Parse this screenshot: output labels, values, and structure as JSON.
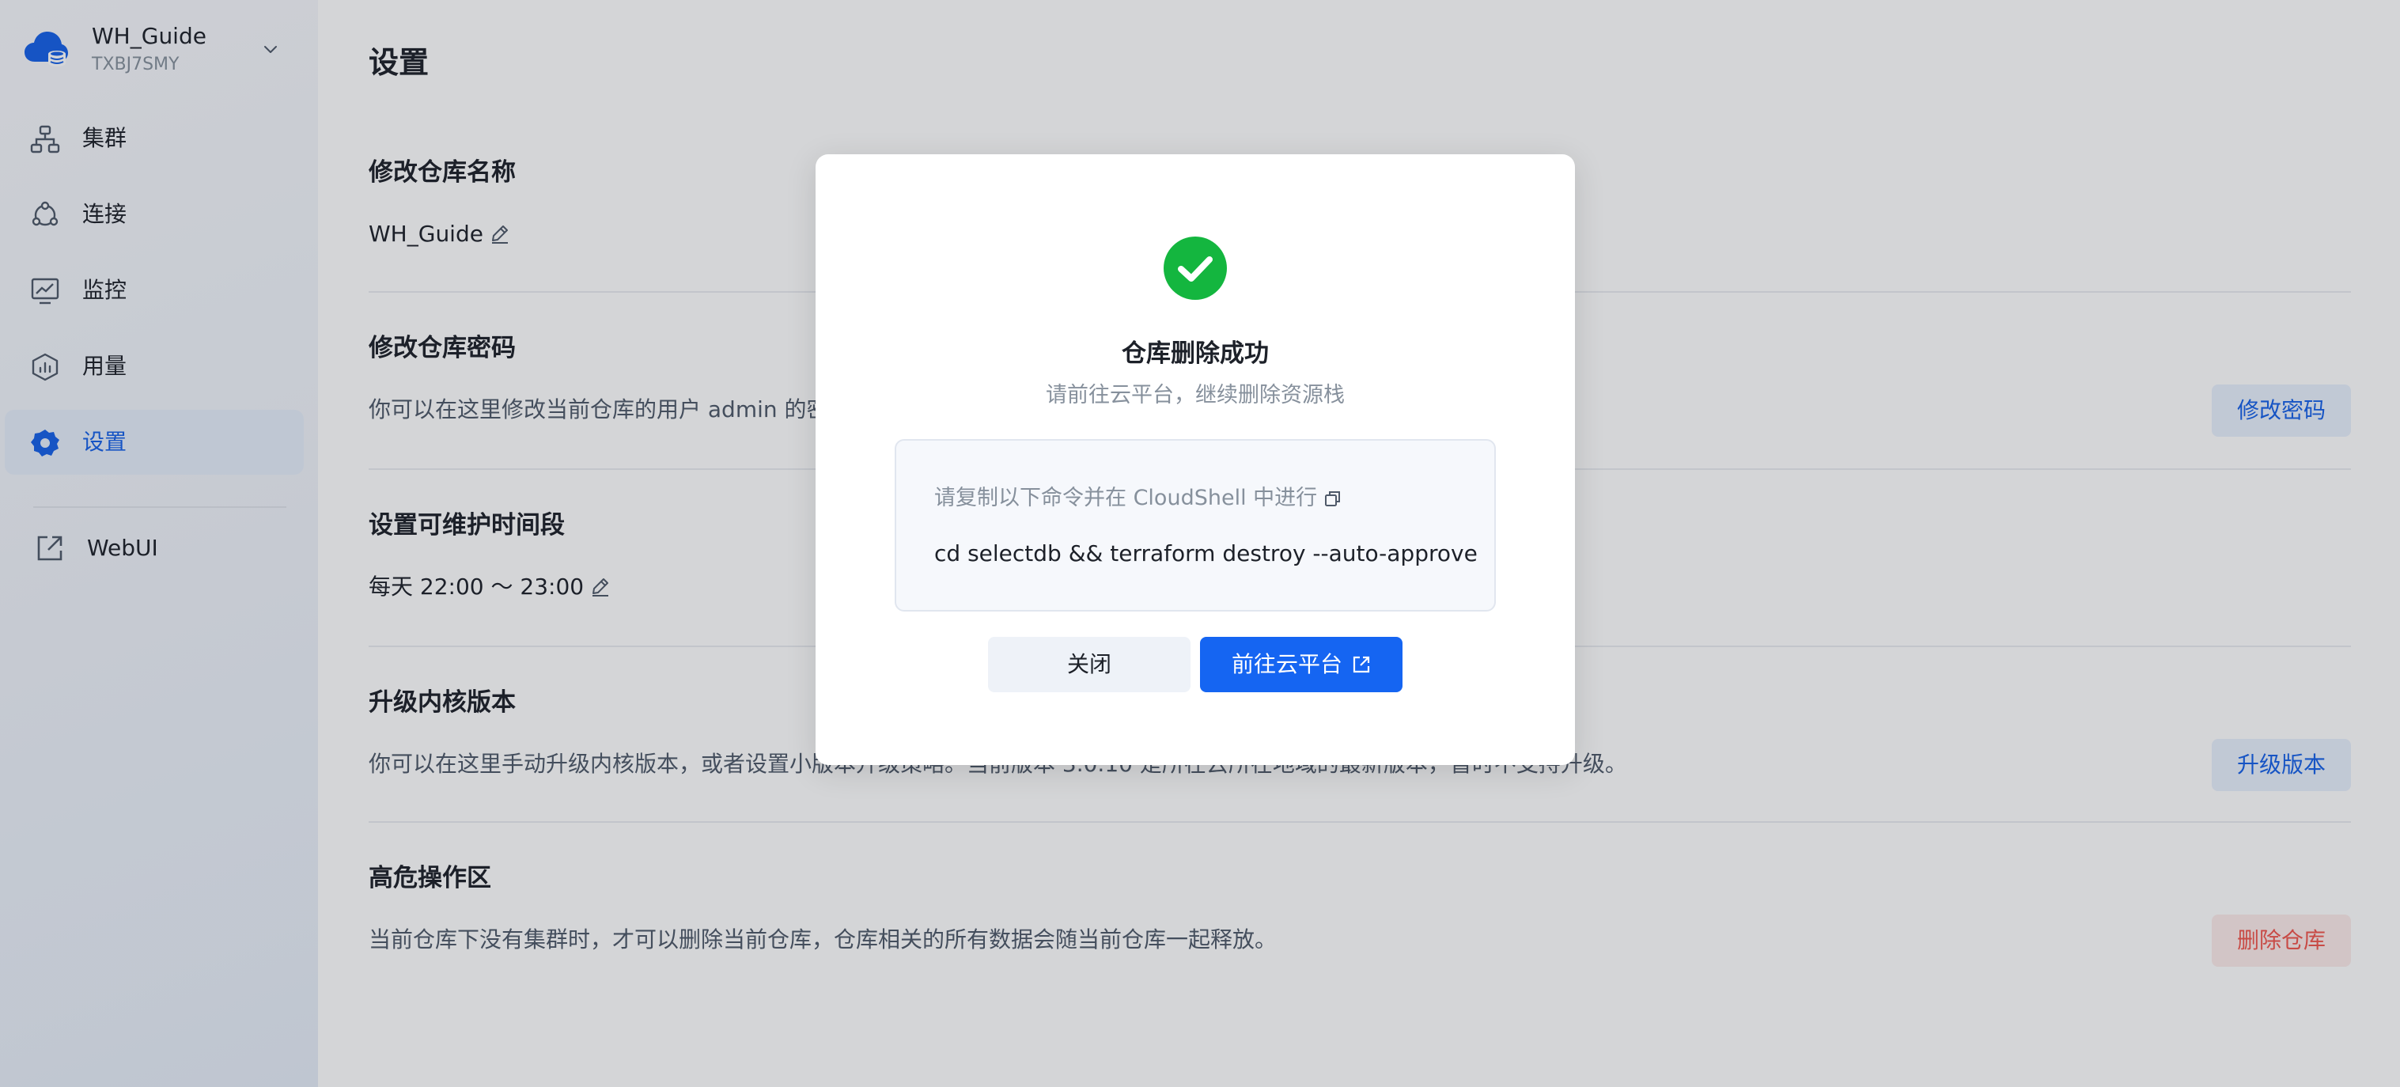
{
  "workspace": {
    "name": "WH_Guide",
    "id": "TXBJ7SMY"
  },
  "sidebar": {
    "items": [
      {
        "label": "集群",
        "icon": "cluster-icon",
        "active": false
      },
      {
        "label": "连接",
        "icon": "connect-icon",
        "active": false
      },
      {
        "label": "监控",
        "icon": "monitor-icon",
        "active": false
      },
      {
        "label": "用量",
        "icon": "usage-icon",
        "active": false
      },
      {
        "label": "设置",
        "icon": "settings-icon",
        "active": true
      }
    ],
    "webui": {
      "label": "WebUI",
      "icon": "external-link-icon"
    }
  },
  "main": {
    "title": "设置",
    "sections": [
      {
        "title": "修改仓库名称",
        "value": "WH_Guide"
      },
      {
        "title": "修改仓库密码",
        "text": "你可以在这里修改当前仓库的用户 admin 的密",
        "button": "修改密码"
      },
      {
        "title": "设置可维护时间段",
        "value": "每天 22:00 ～ 23:00"
      },
      {
        "title": "升级内核版本",
        "text": "你可以在这里手动升级内核版本，或者设置小版本升级策略。当前版本 3.0.10 是所在云所在地域的最新版本，暂时不支持升级。",
        "button": "升级版本"
      },
      {
        "title": "高危操作区",
        "text": "当前仓库下没有集群时，才可以删除当前仓库，仓库相关的所有数据会随当前仓库一起释放。",
        "button": "删除仓库"
      }
    ]
  },
  "modal": {
    "title": "仓库删除成功",
    "subtitle": "请前往云平台，继续删除资源栈",
    "command_hint": "请复制以下命令并在 CloudShell 中进行",
    "command": "cd selectdb && terraform destroy --auto-approve",
    "close_label": "关闭",
    "go_label": "前往云平台"
  },
  "colors": {
    "accent": "#1565f2",
    "success": "#14b63f",
    "danger": "#f0564d"
  }
}
